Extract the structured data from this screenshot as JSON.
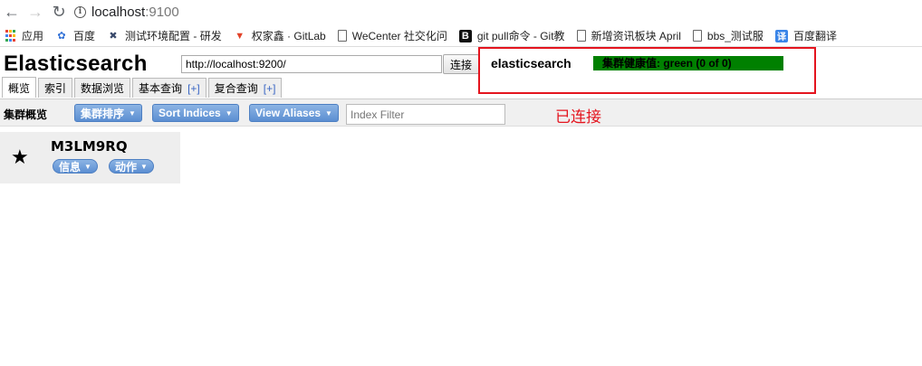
{
  "browser": {
    "url_host": "localhost",
    "url_port": ":9100",
    "bookmarks": [
      {
        "icon": "apps-grid-icon",
        "label": "应用"
      },
      {
        "icon": "baidu-paw-icon",
        "label": "百度"
      },
      {
        "icon": "tools-icon",
        "label": "测试环境配置 - 研发"
      },
      {
        "icon": "gitlab-icon",
        "label": "权家鑫 · GitLab"
      },
      {
        "icon": "document-icon",
        "label": "WeCenter 社交化问"
      },
      {
        "icon": "bold-b-icon",
        "label": "git pull命令 - Git教"
      },
      {
        "icon": "document-icon",
        "label": "新增资讯板块 April"
      },
      {
        "icon": "document-icon",
        "label": "bbs_测试服"
      },
      {
        "icon": "translate-icon",
        "label": "百度翻译"
      }
    ]
  },
  "app": {
    "title": "Elasticsearch",
    "connect_url": "http://localhost:9200/",
    "connect_label": "连接",
    "cluster_name": "elasticsearch",
    "health_text": "集群健康值: green (0 of 0)",
    "health_color": "#008000",
    "connected_note": "已连接"
  },
  "tabs": [
    {
      "label": "概览",
      "plus": ""
    },
    {
      "label": "索引",
      "plus": ""
    },
    {
      "label": "数据浏览",
      "plus": ""
    },
    {
      "label": "基本查询",
      "plus": "[+]"
    },
    {
      "label": "复合查询",
      "plus": "[+]"
    }
  ],
  "toolbar": {
    "title": "集群概览",
    "sort_cluster": "集群排序",
    "sort_indices": "Sort Indices",
    "view_aliases": "View Aliases",
    "filter_placeholder": "Index Filter"
  },
  "node": {
    "name": "M3LM9RQ",
    "info_label": "信息",
    "action_label": "动作"
  }
}
